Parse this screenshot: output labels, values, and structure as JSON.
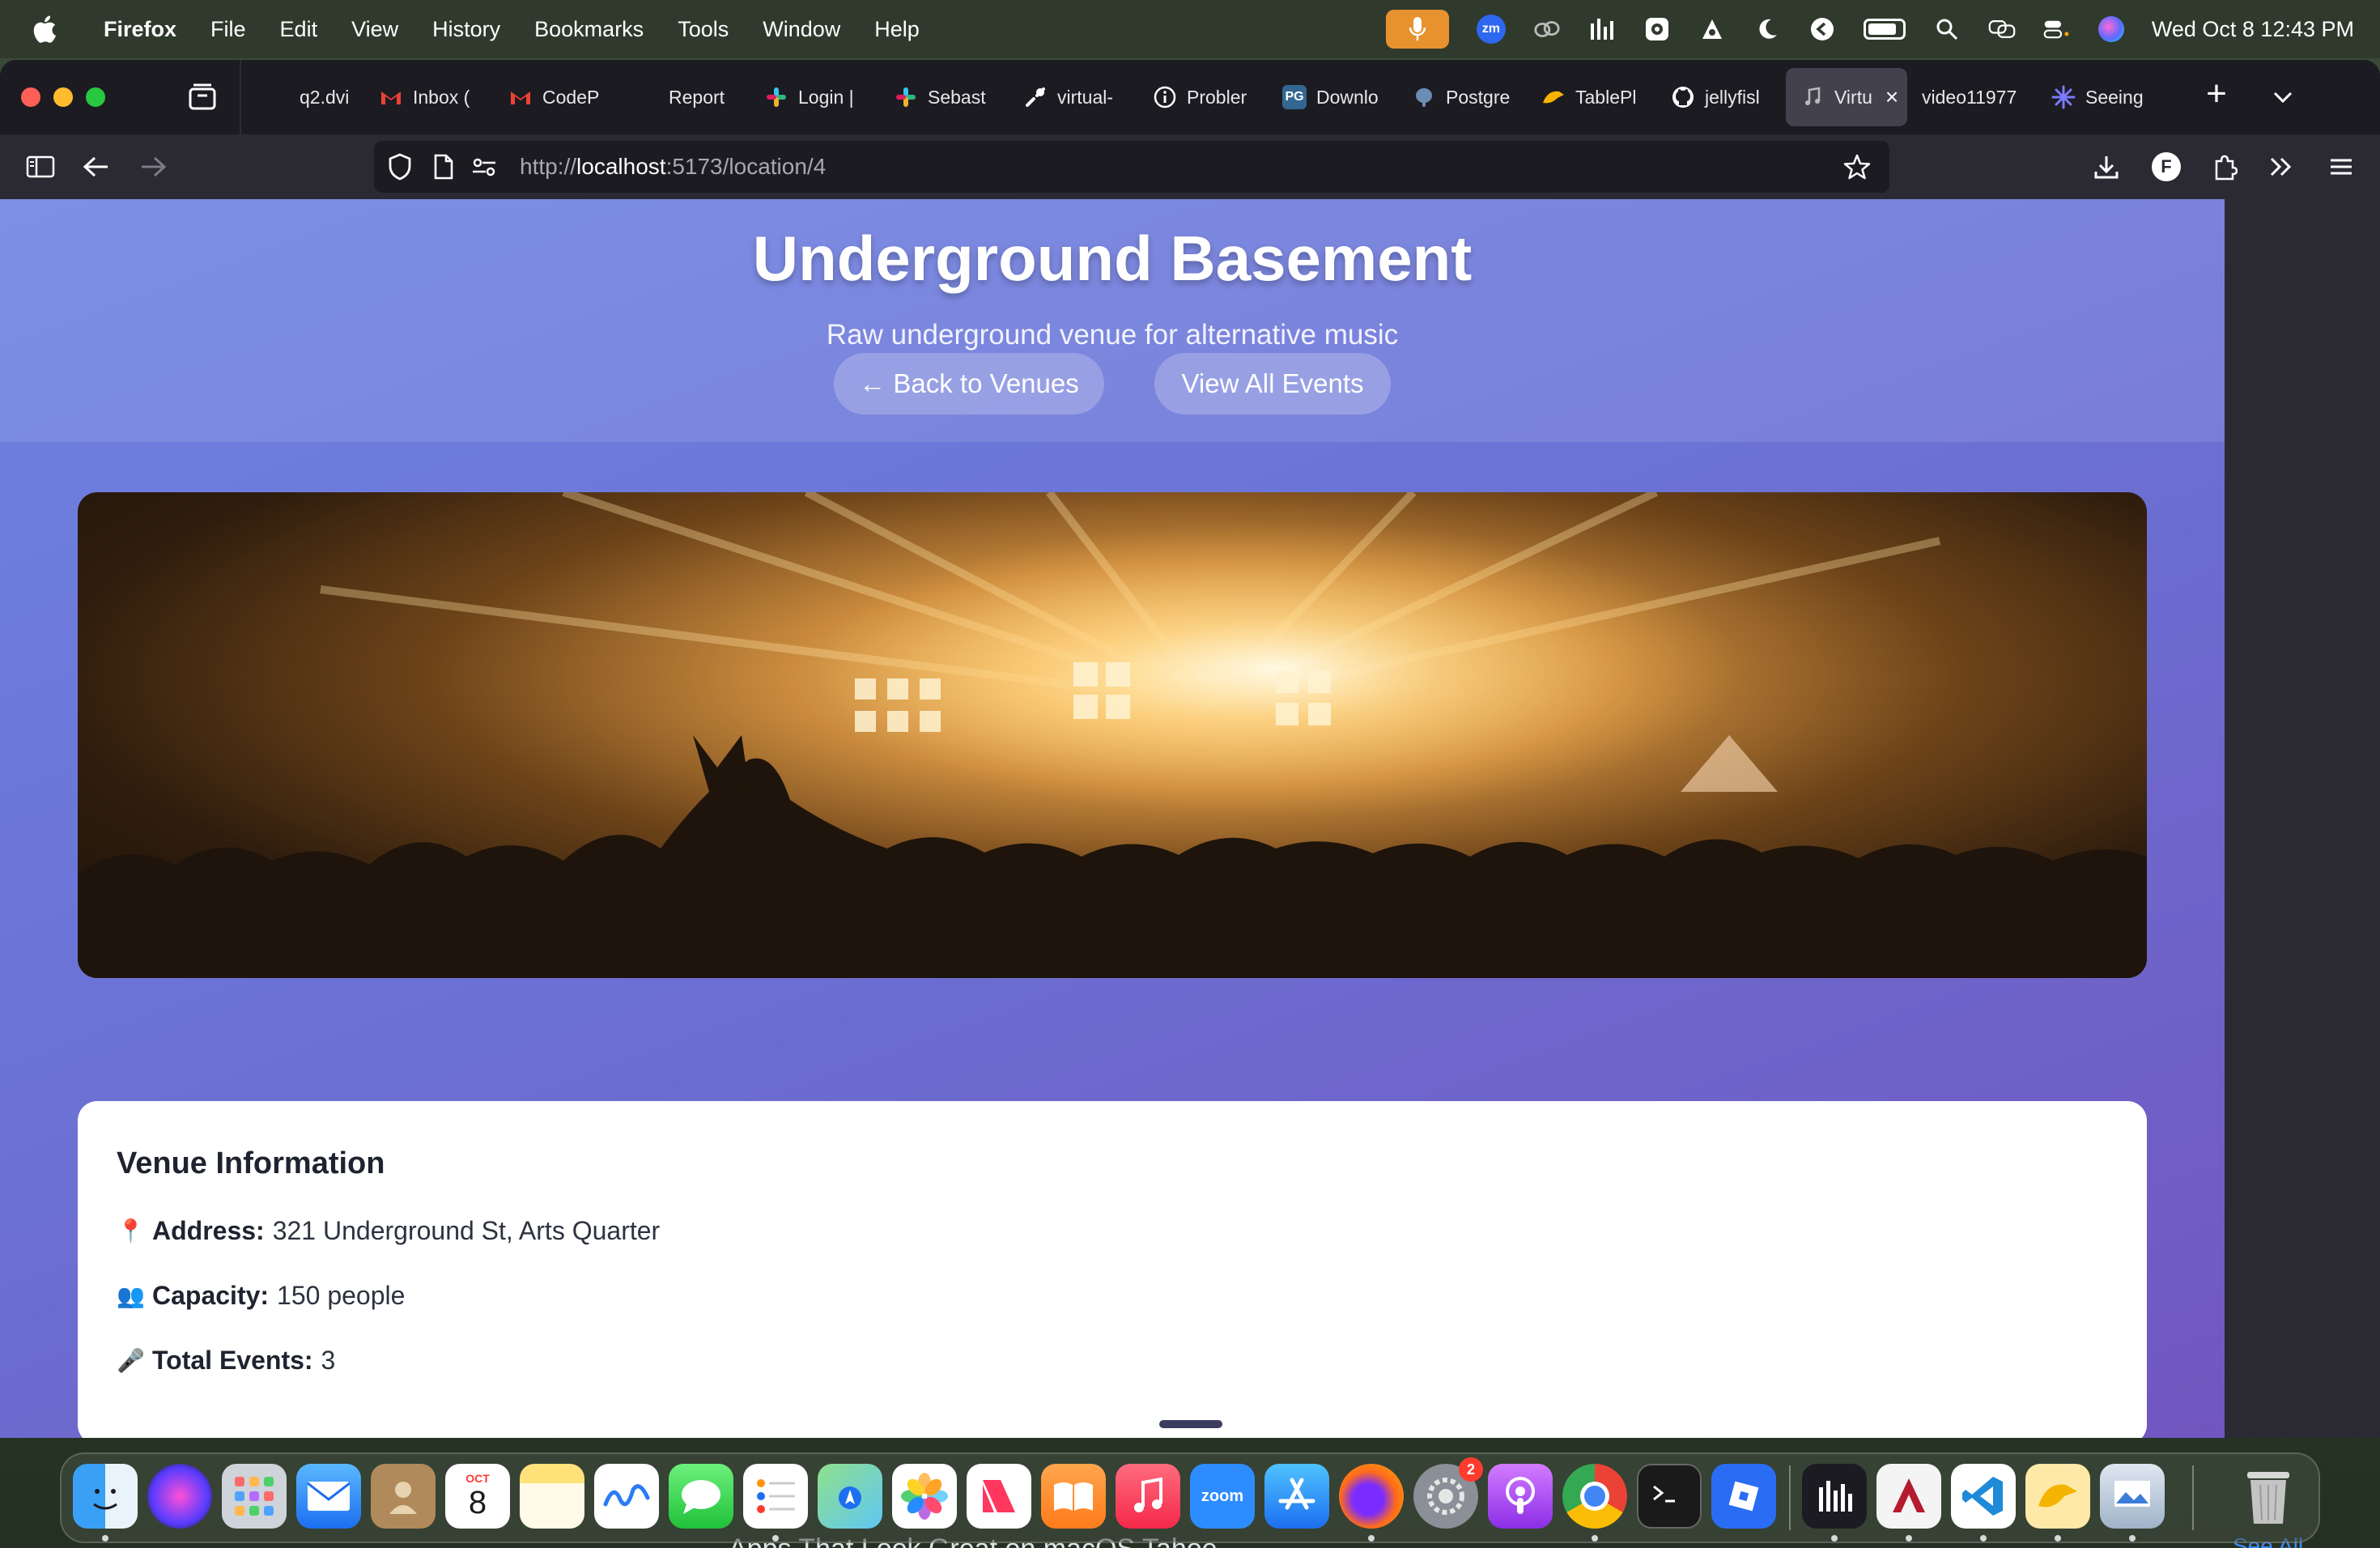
{
  "menubar": {
    "app_name": "Firefox",
    "items": [
      "File",
      "Edit",
      "View",
      "History",
      "Bookmarks",
      "Tools",
      "Window",
      "Help"
    ],
    "zoom_label": "zm",
    "clock": "Wed Oct 8  12:43 PM"
  },
  "tabs": [
    {
      "label": "q2.dvi",
      "icon": "document-icon",
      "color": "#1c1b22"
    },
    {
      "label": "Inbox (",
      "icon": "gmail-icon",
      "color": "#ea4335"
    },
    {
      "label": "CodeP",
      "icon": "gmail-icon",
      "color": "#ea4335"
    },
    {
      "label": "Report",
      "icon": "document-icon",
      "color": "#1c1b22"
    },
    {
      "label": "Login |",
      "icon": "slack-icon",
      "color": "#4a154b"
    },
    {
      "label": "Sebast",
      "icon": "slack-icon",
      "color": "#4a154b"
    },
    {
      "label": "virtual-",
      "icon": "link-icon",
      "color": "#1c1b22"
    },
    {
      "label": "Probler",
      "icon": "info-icon",
      "color": "#1c1b22"
    },
    {
      "label": "Downlo",
      "icon": "pg-icon",
      "color": "#336791"
    },
    {
      "label": "Postgre",
      "icon": "elephant-icon",
      "color": "#1c1b22"
    },
    {
      "label": "TablePl",
      "icon": "tableplus-icon",
      "color": "#f5b400"
    },
    {
      "label": "jellyfisl",
      "icon": "github-icon",
      "color": "#1c1b22"
    },
    {
      "label": "Virtu",
      "icon": "music-note-icon",
      "color": "#42414d",
      "active": true
    },
    {
      "label": "video11977",
      "icon": "none",
      "color": "#1c1b22"
    },
    {
      "label": "Seeing",
      "icon": "sparkle-icon",
      "color": "#5b5bf0"
    }
  ],
  "navbar": {
    "url_prefix": "http://",
    "url_host": "localhost",
    "url_rest": ":5173/location/4"
  },
  "page": {
    "title": "Underground Basement",
    "subtitle": "Raw underground venue for alternative music",
    "back_button": "← Back to Venues",
    "events_button": "View All Events"
  },
  "venue_info": {
    "heading": "Venue Information",
    "rows": [
      {
        "emoji": "📍",
        "label": "Address:",
        "value": "321 Underground St, Arts Quarter"
      },
      {
        "emoji": "👥",
        "label": "Capacity:",
        "value": "150 people"
      },
      {
        "emoji": "🎤",
        "label": "Total Events:",
        "value": "3"
      }
    ]
  },
  "dock": {
    "calendar_month": "OCT",
    "calendar_day": "8",
    "settings_badge": "2",
    "zoom_label": "zoom",
    "apps": [
      "Finder",
      "Siri",
      "Launchpad",
      "Mail",
      "Contacts",
      "Calendar",
      "Notes",
      "Freeform",
      "Messages",
      "Reminders",
      "Maps",
      "Photos",
      "News",
      "Books",
      "Music",
      "Zoom",
      "App Store",
      "Firefox",
      "System Settings",
      "Podcasts",
      "Chrome",
      "Terminal",
      "Roblox",
      "Instruments",
      "Cursor",
      "VS Code",
      "TablePlus",
      "Preview",
      "Trash"
    ]
  },
  "background": {
    "partial_text": "Apps That Look Great on macOS Tahoe",
    "link_text": "See All"
  }
}
